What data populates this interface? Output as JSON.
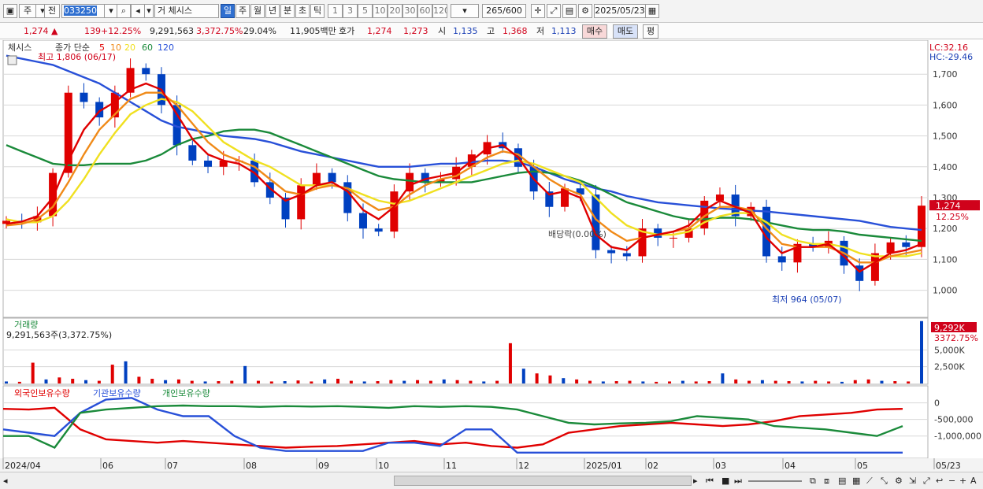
{
  "toolbar": {
    "market": "주",
    "type_label": "전",
    "code": "033250",
    "volume_label": "거",
    "stock_name": "체시스",
    "periods": [
      "일",
      "주",
      "월",
      "년",
      "분",
      "초",
      "틱"
    ],
    "active_period": "일",
    "minutes": [
      "1",
      "3",
      "5",
      "10",
      "20",
      "30",
      "60",
      "120"
    ],
    "count": "265/600",
    "date": "2025/05/23"
  },
  "info": {
    "price": "1,274",
    "change": "139",
    "change_pct": "+12.25%",
    "volume": "9,291,563",
    "volume_ratio": "3,372.75%",
    "turnover": "29.04%",
    "amount": "11,905백만",
    "hoga_label": "호가",
    "ask": "1,274",
    "bid": "1,273",
    "open_label": "시",
    "open": "1,135",
    "high_label": "고",
    "high": "1,368",
    "low_label": "저",
    "low": "1,113",
    "buy_label": "매수",
    "sell_label": "매도",
    "eval_label": "평"
  },
  "legend": {
    "name": "체시스",
    "ma_label": "종가 단순",
    "ma_periods": [
      "5",
      "10",
      "20",
      "60",
      "120"
    ],
    "ma_colors": [
      "#e00000",
      "#f08a18",
      "#f0e020",
      "#1a8a3a",
      "#2850d8"
    ]
  },
  "colors": {
    "up": "#e00000",
    "down": "#0040c0",
    "grid": "#d8d8d8"
  },
  "chart_data": [
    {
      "type": "candlestick",
      "title": "체시스",
      "annotations": {
        "high": "최고 1,806 (06/17)",
        "low": "최저 964 (05/07)",
        "dividend": "배당락(0.00%)"
      },
      "yticks": [
        "1,700",
        "1,600",
        "1,500",
        "1,400",
        "1,300",
        "1,200",
        "1,100",
        "1,000"
      ],
      "ytick_values": [
        1700,
        1600,
        1500,
        1400,
        1300,
        1200,
        1100,
        1000
      ],
      "ylim": [
        930,
        1800
      ],
      "lc": "LC:32.16",
      "hc": "HC:-29.46",
      "current_price_label": "1,274",
      "current_change_label": "12.25%",
      "current_price": 1274,
      "x_labels": [
        "2024/04",
        "06",
        "07",
        "08",
        "09",
        "10",
        "11",
        "12",
        "2025/01",
        "02",
        "03",
        "04",
        "05",
        "05/23"
      ],
      "closes": [
        1225,
        1220,
        1240,
        1380,
        1640,
        1610,
        1560,
        1640,
        1720,
        1700,
        1600,
        1470,
        1420,
        1400,
        1420,
        1420,
        1350,
        1300,
        1230,
        1340,
        1380,
        1350,
        1250,
        1200,
        1190,
        1320,
        1380,
        1350,
        1360,
        1400,
        1440,
        1480,
        1460,
        1400,
        1320,
        1270,
        1330,
        1310,
        1130,
        1120,
        1110,
        1200,
        1170,
        1170,
        1200,
        1290,
        1310,
        1240,
        1270,
        1110,
        1090,
        1150,
        1140,
        1160,
        1080,
        1030,
        1120,
        1155,
        1140,
        1274
      ],
      "ma5": [
        1215,
        1222,
        1240,
        1300,
        1420,
        1520,
        1580,
        1610,
        1650,
        1670,
        1650,
        1570,
        1490,
        1440,
        1420,
        1410,
        1380,
        1330,
        1290,
        1310,
        1340,
        1350,
        1320,
        1260,
        1230,
        1270,
        1340,
        1360,
        1370,
        1380,
        1420,
        1460,
        1470,
        1430,
        1360,
        1310,
        1320,
        1300,
        1180,
        1140,
        1130,
        1170,
        1180,
        1190,
        1210,
        1260,
        1290,
        1270,
        1250,
        1170,
        1120,
        1140,
        1140,
        1150,
        1110,
        1060,
        1090,
        1120,
        1130,
        1150
      ],
      "ma10": [
        1210,
        1215,
        1230,
        1270,
        1350,
        1440,
        1520,
        1570,
        1620,
        1640,
        1640,
        1600,
        1540,
        1480,
        1440,
        1420,
        1400,
        1360,
        1320,
        1310,
        1330,
        1340,
        1330,
        1290,
        1260,
        1270,
        1310,
        1340,
        1360,
        1370,
        1400,
        1430,
        1450,
        1440,
        1400,
        1360,
        1330,
        1310,
        1230,
        1190,
        1160,
        1170,
        1180,
        1190,
        1200,
        1240,
        1270,
        1270,
        1260,
        1200,
        1150,
        1140,
        1140,
        1140,
        1120,
        1090,
        1090,
        1110,
        1120,
        1130
      ],
      "ma20": [
        1230,
        1220,
        1220,
        1240,
        1290,
        1360,
        1440,
        1510,
        1570,
        1600,
        1620,
        1610,
        1580,
        1530,
        1480,
        1450,
        1420,
        1400,
        1370,
        1340,
        1340,
        1340,
        1330,
        1310,
        1290,
        1280,
        1290,
        1310,
        1330,
        1350,
        1370,
        1390,
        1410,
        1420,
        1410,
        1390,
        1370,
        1350,
        1300,
        1250,
        1210,
        1190,
        1180,
        1180,
        1190,
        1220,
        1240,
        1250,
        1250,
        1220,
        1180,
        1160,
        1150,
        1150,
        1140,
        1120,
        1110,
        1110,
        1110,
        1120
      ],
      "ma60": [
        1470,
        1450,
        1430,
        1410,
        1405,
        1405,
        1410,
        1410,
        1410,
        1420,
        1440,
        1470,
        1490,
        1500,
        1515,
        1520,
        1520,
        1510,
        1490,
        1470,
        1450,
        1430,
        1410,
        1390,
        1370,
        1360,
        1355,
        1350,
        1350,
        1350,
        1350,
        1360,
        1370,
        1380,
        1385,
        1380,
        1370,
        1355,
        1335,
        1310,
        1285,
        1270,
        1255,
        1240,
        1230,
        1230,
        1235,
        1235,
        1230,
        1220,
        1210,
        1200,
        1195,
        1195,
        1190,
        1180,
        1175,
        1170,
        1165,
        1160
      ],
      "ma120": [
        1760,
        1750,
        1740,
        1730,
        1710,
        1690,
        1670,
        1640,
        1610,
        1580,
        1550,
        1530,
        1520,
        1510,
        1500,
        1495,
        1490,
        1480,
        1465,
        1450,
        1440,
        1430,
        1420,
        1410,
        1400,
        1400,
        1400,
        1405,
        1410,
        1410,
        1415,
        1420,
        1420,
        1415,
        1400,
        1380,
        1360,
        1345,
        1330,
        1320,
        1305,
        1295,
        1285,
        1280,
        1275,
        1270,
        1265,
        1262,
        1258,
        1255,
        1250,
        1245,
        1240,
        1235,
        1230,
        1225,
        1215,
        1205,
        1200,
        1195
      ]
    },
    {
      "type": "bar",
      "title": "거래량",
      "total_label": "9,291,563주(3,372.75%)",
      "yticks": [
        "5,000K",
        "2,500K"
      ],
      "ytick_values": [
        5000,
        2500
      ],
      "ylim": [
        0,
        9500
      ],
      "current_label": "9,292K",
      "current_pct_label": "3372.75%",
      "values": [
        300,
        250,
        3100,
        600,
        900,
        700,
        500,
        400,
        2800,
        3300,
        1000,
        700,
        500,
        600,
        400,
        300,
        350,
        400,
        2600,
        400,
        300,
        350,
        450,
        300,
        600,
        700,
        400,
        300,
        350,
        500,
        400,
        500,
        400,
        600,
        500,
        400,
        300,
        400,
        6000,
        2200,
        1500,
        1200,
        800,
        600,
        400,
        300,
        350,
        400,
        300,
        250,
        300,
        400,
        300,
        350,
        1500,
        600,
        400,
        500,
        400,
        350,
        300,
        400,
        300,
        250,
        500,
        600,
        400,
        350,
        300,
        9292
      ]
    },
    {
      "type": "line",
      "title": "외국인보유수량",
      "series": [
        {
          "name": "외국인보유수량",
          "color": "#e00000",
          "values": [
            -180000,
            -200000,
            -150000,
            -800000,
            -1100000,
            -1150000,
            -1200000,
            -1150000,
            -1200000,
            -1250000,
            -1300000,
            -1350000,
            -1320000,
            -1300000,
            -1250000,
            -1200000,
            -1150000,
            -1250000,
            -1200000,
            -1300000,
            -1350000,
            -1250000,
            -900000,
            -800000,
            -700000,
            -650000,
            -600000,
            -650000,
            -700000,
            -650000,
            -550000,
            -400000,
            -350000,
            -300000,
            -200000,
            -180000
          ]
        },
        {
          "name": "기관보유수량",
          "color": "#2850d8",
          "values": [
            -800000,
            -900000,
            -1000000,
            -300000,
            100000,
            150000,
            -200000,
            -400000,
            -400000,
            -1000000,
            -1350000,
            -1450000,
            -1450000,
            -1450000,
            -1450000,
            -1200000,
            -1200000,
            -1300000,
            -800000,
            -800000,
            -1500000,
            -1500000,
            -1500000,
            -1500000,
            -1500000,
            -1500000,
            -1500000,
            -1500000,
            -1500000,
            -1500000,
            -1500000,
            -1500000,
            -1500000,
            -1500000,
            -1500000,
            -1500000
          ]
        },
        {
          "name": "개인보유수량",
          "color": "#1a8a3a",
          "values": [
            -1000000,
            -1000000,
            -1350000,
            -300000,
            -200000,
            -150000,
            -100000,
            -80000,
            -100000,
            -100000,
            -120000,
            -100000,
            -110000,
            -100000,
            -120000,
            -150000,
            -100000,
            -120000,
            -100000,
            -120000,
            -200000,
            -400000,
            -600000,
            -650000,
            -620000,
            -600000,
            -550000,
            -400000,
            -450000,
            -500000,
            -700000,
            -750000,
            -800000,
            -900000,
            -1000000,
            -700000
          ]
        }
      ],
      "yticks": [
        "0",
        "-500,000",
        "-1,000,000"
      ],
      "ytick_values": [
        0,
        -500000,
        -1000000
      ],
      "ylim": [
        -1600000,
        300000
      ]
    }
  ]
}
